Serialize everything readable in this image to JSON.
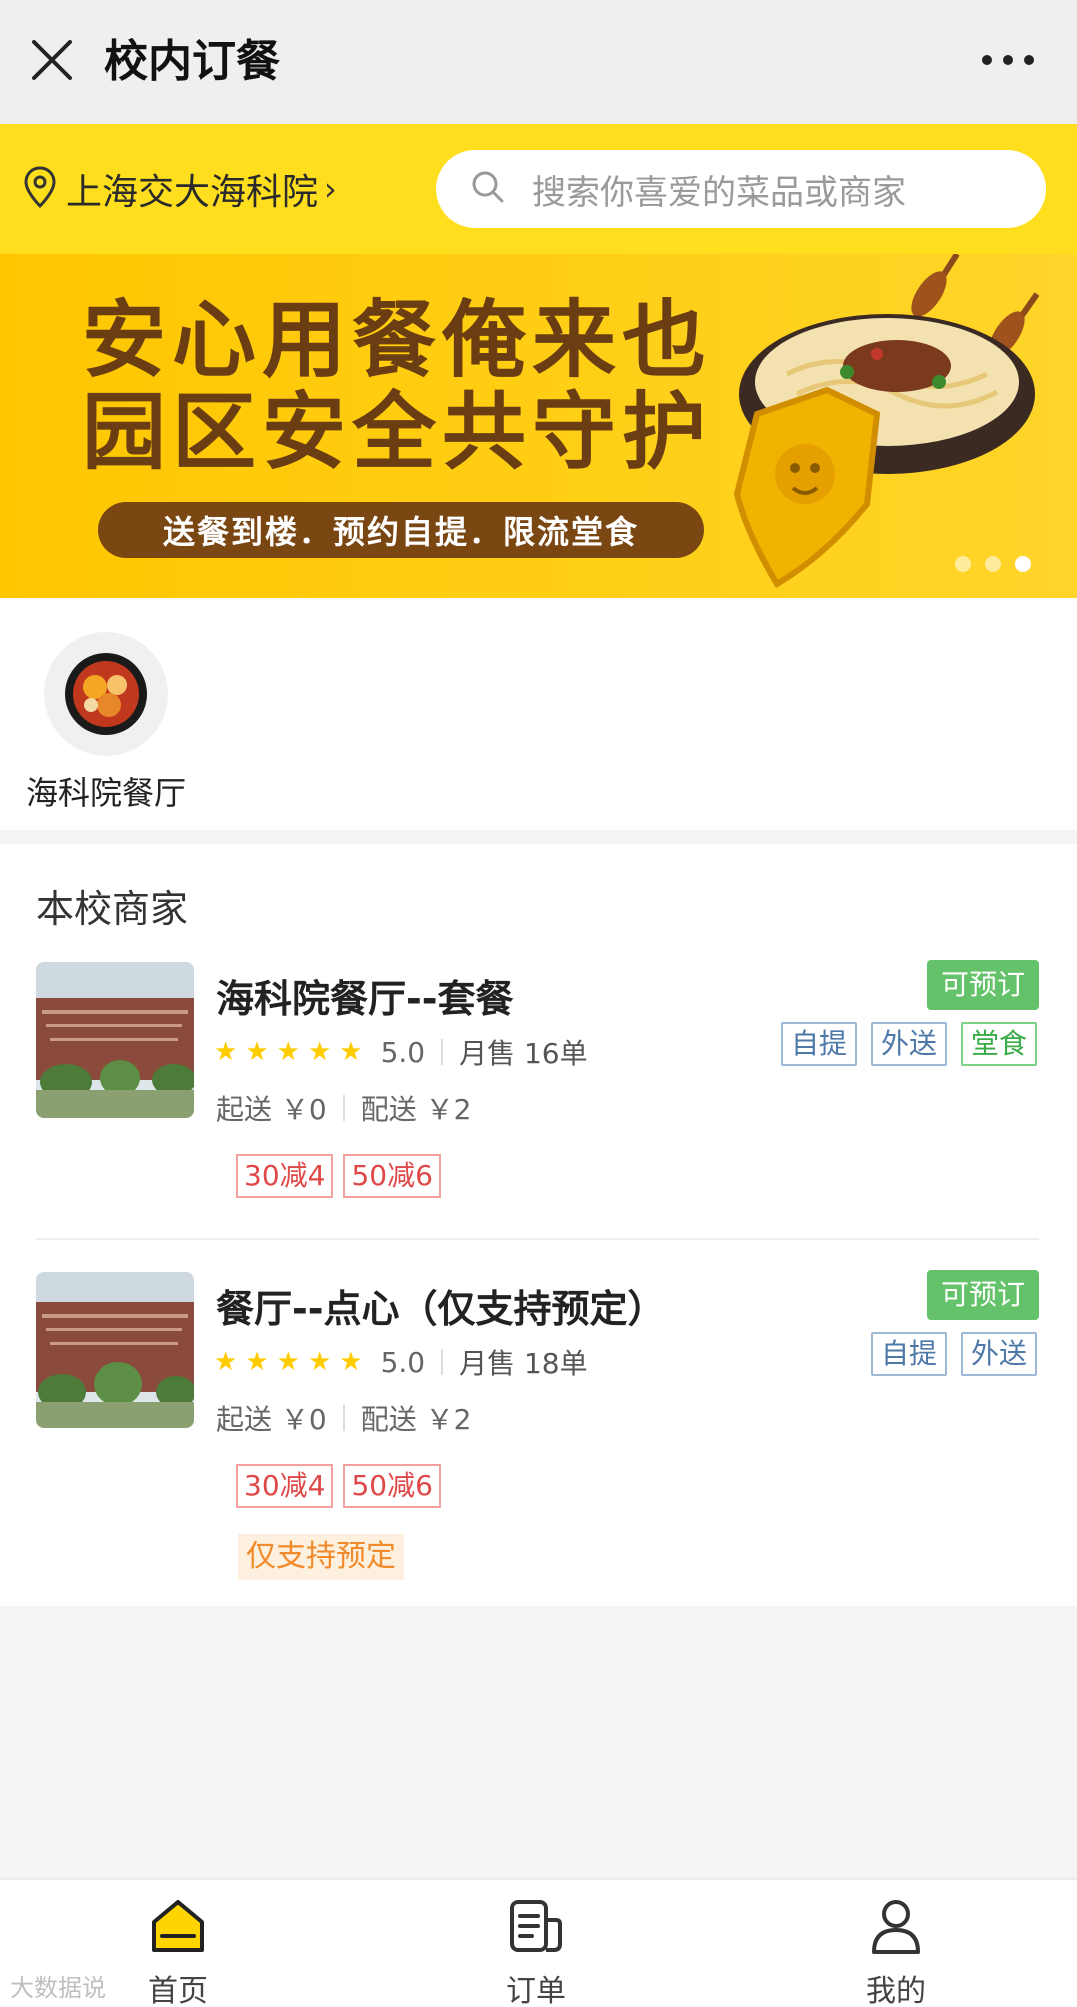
{
  "app": {
    "title": "校内订餐"
  },
  "header": {
    "location": "上海交大海科院",
    "search_placeholder": "搜索你喜爱的菜品或商家"
  },
  "banner": {
    "line1": "安心用餐俺来也",
    "line2": "园区安全共守护",
    "pill": "送餐到楼．预约自提．限流堂食",
    "active_dot": 3,
    "dot_count": 3
  },
  "categories": [
    {
      "label": "海科院餐厅"
    }
  ],
  "merchants_section": {
    "title": "本校商家",
    "items": [
      {
        "name": "海科院餐厅--套餐",
        "rating": "5.0",
        "stars": 5,
        "sales": "月售 16单",
        "min_order": "起送 ￥0",
        "delivery_fee": "配送 ￥2",
        "status": "可预订",
        "tags": [
          "自提",
          "外送",
          "堂食"
        ],
        "promos": [
          "30减4",
          "50减6"
        ]
      },
      {
        "name": "餐厅--点心（仅支持预定）",
        "rating": "5.0",
        "stars": 5,
        "sales": "月售 18单",
        "min_order": "起送 ￥0",
        "delivery_fee": "配送 ￥2",
        "status": "可预订",
        "tags": [
          "自提",
          "外送"
        ],
        "promos": [
          "30减4",
          "50减6"
        ],
        "note": "仅支持预定"
      }
    ]
  },
  "tabbar": {
    "home": "首页",
    "orders": "订单",
    "mine": "我的",
    "active": "home"
  },
  "colors": {
    "accent_yellow": "#ffde1e",
    "available_green": "#64c36a",
    "promo_red": "#e04848",
    "tag_blue": "#4e78a8"
  },
  "watermark": "大数据说"
}
